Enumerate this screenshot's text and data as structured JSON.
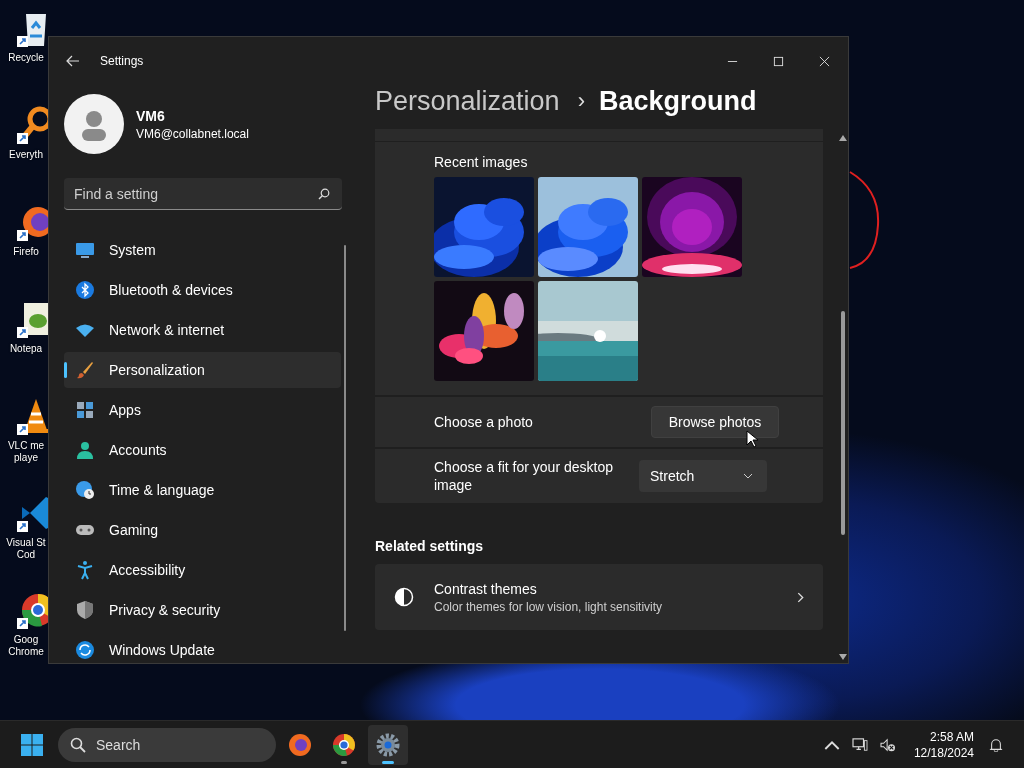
{
  "desktop_icons": [
    {
      "kind": "recycle",
      "label": "Recycle"
    },
    {
      "kind": "magnifier",
      "label": "Everyth"
    },
    {
      "kind": "foxglobe",
      "label": "Firefo"
    },
    {
      "kind": "notepad",
      "label": "Notepa"
    },
    {
      "kind": "cone",
      "label": "VLC me playe"
    },
    {
      "kind": "ribbon",
      "label": "Visual St Cod"
    },
    {
      "kind": "chromering",
      "label": "Goog Chrome"
    }
  ],
  "window": {
    "title": "Settings"
  },
  "profile": {
    "name": "VM6",
    "email": "VM6@collabnet.local"
  },
  "search": {
    "placeholder": "Find a setting"
  },
  "nav": [
    {
      "kind": "system",
      "label": "System",
      "selected": false
    },
    {
      "kind": "bluetooth",
      "label": "Bluetooth & devices",
      "selected": false
    },
    {
      "kind": "network",
      "label": "Network & internet",
      "selected": false
    },
    {
      "kind": "brush",
      "label": "Personalization",
      "selected": true
    },
    {
      "kind": "apps",
      "label": "Apps",
      "selected": false
    },
    {
      "kind": "accounts",
      "label": "Accounts",
      "selected": false
    },
    {
      "kind": "time",
      "label": "Time & language",
      "selected": false
    },
    {
      "kind": "gaming",
      "label": "Gaming",
      "selected": false
    },
    {
      "kind": "accessibility",
      "label": "Accessibility",
      "selected": false
    },
    {
      "kind": "privacy",
      "label": "Privacy & security",
      "selected": false
    },
    {
      "kind": "update",
      "label": "Windows Update",
      "selected": false
    }
  ],
  "breadcrumb": {
    "parent": "Personalization",
    "separator": "›",
    "current": "Background"
  },
  "recent_images": {
    "label": "Recent images"
  },
  "choose_photo": {
    "label": "Choose a photo",
    "button": "Browse photos"
  },
  "fit": {
    "label": "Choose a fit for your desktop image",
    "value": "Stretch"
  },
  "related": {
    "heading": "Related settings",
    "items": [
      {
        "title": "Contrast themes",
        "subtitle": "Color themes for low vision, light sensitivity"
      }
    ]
  },
  "taskbar": {
    "search": "Search",
    "apps": [
      {
        "kind": "foxglobe",
        "running": false,
        "selected": false
      },
      {
        "kind": "chromering",
        "running": true,
        "selected": false
      },
      {
        "kind": "gear",
        "running": true,
        "selected": true
      }
    ],
    "time": "2:58 AM",
    "date": "12/18/2024"
  }
}
